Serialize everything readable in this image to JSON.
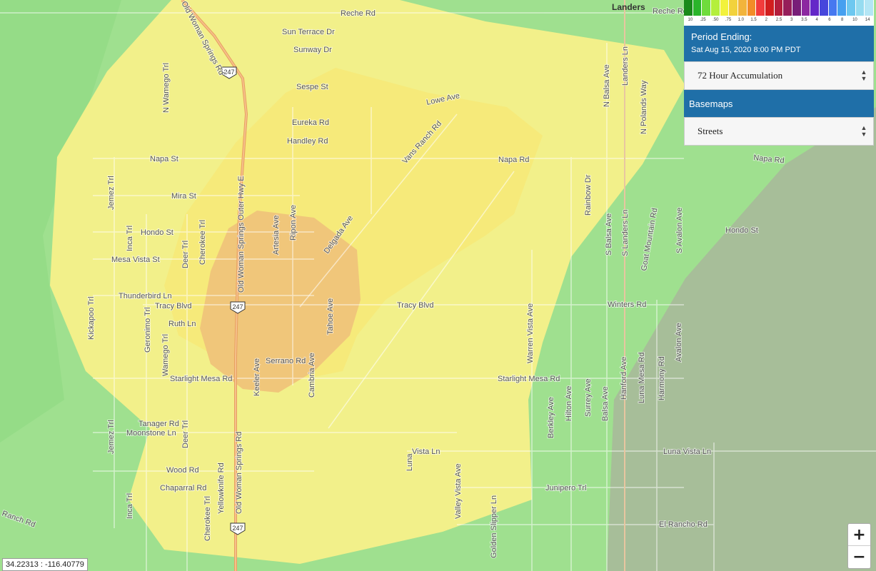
{
  "map": {
    "town": "Landers",
    "route_shield": "247",
    "roads": {
      "reche_rd": "Reche Rd",
      "reche_rd_2": "Reche Rd",
      "sun_terrace": "Sun Terrace Dr",
      "sunway": "Sunway Dr",
      "sespe": "Sespe St",
      "lowe": "Lowe Ave",
      "eureka": "Eureka Rd",
      "handley": "Handley Rd",
      "vans_ranch": "Vans Ranch Rd",
      "napa_w": "Napa St",
      "napa_c": "Napa Rd",
      "napa_e": "Napa Rd",
      "mira": "Mira St",
      "hondo_w": "Hondo St",
      "hondo_e": "Hondo St",
      "mesa_vista": "Mesa Vista St",
      "thunderbird": "Thunderbird Ln",
      "tracy_w": "Tracy Blvd",
      "tracy_c": "Tracy Blvd",
      "winters": "Winters Rd",
      "ruth": "Ruth Ln",
      "serrano": "Serrano Rd",
      "starlight_w": "Starlight Mesa Rd",
      "starlight_e": "Starlight Mesa Rd",
      "tanager": "Tanager Rd",
      "moonstone": "Moonstone Ln",
      "wood": "Wood Rd",
      "chaparral": "Chaparral Rd",
      "ranch": "Ranch Rd",
      "luna_vista": "Luna Vista Ln",
      "vista_ln": "Vista Ln",
      "junipero": "Junipero Trl",
      "el_rancho": "El Rancho Rd",
      "old_woman_springs_n": "Old Woman Springs Rd",
      "old_woman_outer": "Old Woman Springs Outer Hwy E",
      "old_woman_springs_s": "Old Woman Springs Rd",
      "n_wamego": "N Wamego Trl",
      "jemez_n": "Jemez Trl",
      "jemez_s": "Jemez Trl",
      "inca_n": "Inca Trl",
      "inca_s": "Inca Trl",
      "kickapoo": "Kickapoo Trl",
      "deer_n": "Deer Trl",
      "deer_s": "Deer Trl",
      "cherokee_n": "Cherokee Trl",
      "cherokee_s": "Cherokee Trl",
      "geronimo": "Geronimo Trl",
      "wamego": "Wamego Trl",
      "yellowknife": "Yellowknife Rd",
      "keeler": "Keeler Ave",
      "cambria": "Cambria Ave",
      "tahoe": "Tahoe Ave",
      "artesia": "Artesia Ave",
      "ripon": "Ripon Ave",
      "delgada": "Delgada Ave",
      "warren_vista": "Warren Vista Ave",
      "rainbow": "Rainbow Dr",
      "n_balsa": "N Balsa Ave",
      "s_balsa": "S Balsa Ave",
      "balsa": "Balsa Ave",
      "landers_ln": "Landers Ln",
      "s_landers": "S Landers Ln",
      "n_polands": "N Polands Way",
      "goat_mountain": "Goat Mountain Rd",
      "s_avalon": "S Avalon Ave",
      "avalon": "Avalon Ave",
      "berkley": "Berkley Ave",
      "hilton": "Hilton Ave",
      "surrey": "Surrey Ave",
      "hanford": "Hanford Ave",
      "luna_mesa": "Luna Mesa Rd",
      "harmony": "Harmony Rd",
      "luna": "Luna",
      "valley_vista": "Valley Vista Ave",
      "golden_slipper": "Golden Slipper Ln"
    }
  },
  "legend": {
    "colors": [
      "#1a8a1a",
      "#2ab52a",
      "#6fdc3c",
      "#b4ef3c",
      "#f2f23c",
      "#f2d23c",
      "#f2b43c",
      "#f28c28",
      "#f23c3c",
      "#d21e1e",
      "#b41e3c",
      "#961e5a",
      "#781e78",
      "#8c28a0",
      "#6428c8",
      "#4646dc",
      "#4678f0",
      "#46a0f0",
      "#6ec8f0",
      "#96dcf0",
      "#b4e6f5"
    ],
    "labels": [
      "10",
      ".25",
      ".50",
      ".75",
      "1.0",
      "1.5",
      "2",
      "2.5",
      "3",
      "3.5",
      "4",
      "6",
      "8",
      "10",
      "14"
    ]
  },
  "panel": {
    "period_title": "Period Ending:",
    "period_date": "Sat Aug 15, 2020 8:00 PM PDT",
    "product_selected": "72 Hour Accumulation",
    "basemaps_title": "Basemaps",
    "basemap_selected": "Streets"
  },
  "zoom": {
    "in_label": "+",
    "out_label": "−"
  },
  "coords": "34.22313 : -116.40779"
}
